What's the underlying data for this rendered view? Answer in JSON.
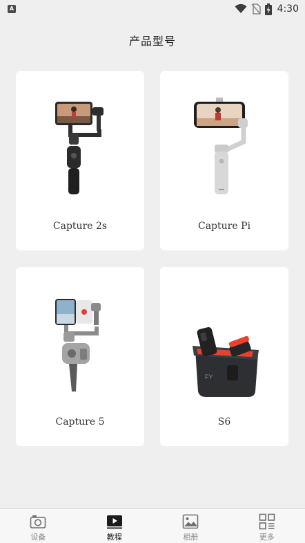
{
  "status_bar": {
    "notification_glyph": "A",
    "time": "4:30"
  },
  "page": {
    "title": "产品型号"
  },
  "products": [
    {
      "name": "Capture 2s",
      "image_icon": "gimbal-dark-icon"
    },
    {
      "name": "Capture Pi",
      "image_icon": "gimbal-white-icon"
    },
    {
      "name": "Capture 5",
      "image_icon": "gimbal-gray-icon"
    },
    {
      "name": "S6",
      "image_icon": "wireless-mic-case-icon"
    }
  ],
  "bottom_nav": {
    "items": [
      {
        "label": "设备",
        "icon": "camera-icon",
        "active": false
      },
      {
        "label": "教程",
        "icon": "play-icon",
        "active": true
      },
      {
        "label": "相册",
        "icon": "gallery-icon",
        "active": false
      },
      {
        "label": "更多",
        "icon": "grid-icon",
        "active": false
      }
    ]
  },
  "colors": {
    "background": "#efefef",
    "card": "#ffffff",
    "accent_red": "#e8412f",
    "active_nav": "#1c1c1c",
    "inactive_nav": "#8a8a8a"
  }
}
